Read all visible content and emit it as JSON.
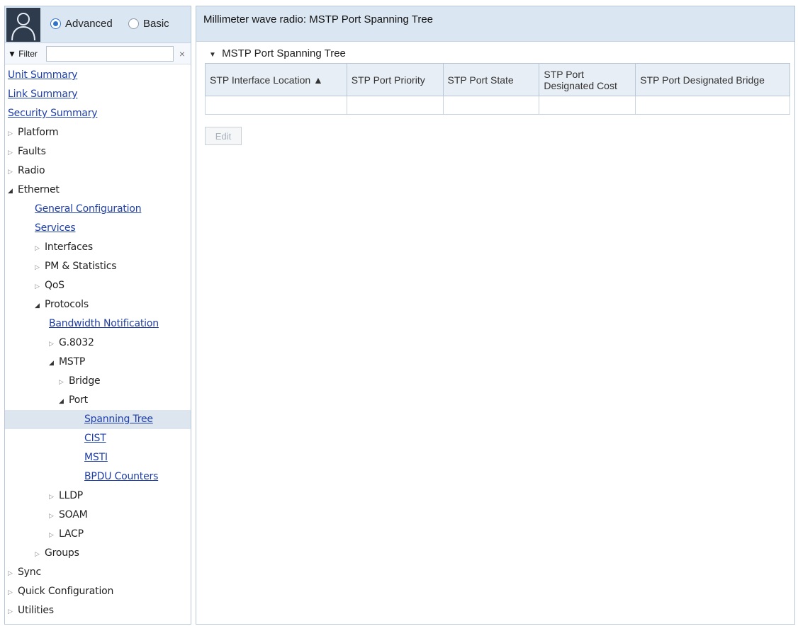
{
  "colors": {
    "header_bg": "#dbe6f3",
    "link": "#1f3fa8",
    "selected_bg": "#dde5ef",
    "avatar_bg": "#2e3b4c",
    "radio_accent": "#2f74c9"
  },
  "sidebar": {
    "avatar_icon": "user-silhouette-icon",
    "mode": {
      "advanced_label": "Advanced",
      "basic_label": "Basic",
      "selected": "Advanced"
    },
    "filter": {
      "label": "▼ Filter",
      "value": "",
      "clear_glyph": "×"
    },
    "tree": [
      {
        "label": "Unit Summary",
        "level": 0,
        "type": "link"
      },
      {
        "label": "Link Summary",
        "level": 0,
        "type": "link"
      },
      {
        "label": "Security Summary",
        "level": 0,
        "type": "link"
      },
      {
        "label": "Platform",
        "level": 0,
        "type": "collapsed"
      },
      {
        "label": "Faults",
        "level": 0,
        "type": "collapsed"
      },
      {
        "label": "Radio",
        "level": 0,
        "type": "collapsed"
      },
      {
        "label": "Ethernet",
        "level": 0,
        "type": "expanded"
      },
      {
        "label": "General Configuration",
        "level": 1,
        "type": "link"
      },
      {
        "label": "Services",
        "level": 1,
        "type": "link"
      },
      {
        "label": "Interfaces",
        "level": 1,
        "type": "collapsed"
      },
      {
        "label": "PM & Statistics",
        "level": 1,
        "type": "collapsed"
      },
      {
        "label": "QoS",
        "level": 1,
        "type": "collapsed"
      },
      {
        "label": "Protocols",
        "level": 1,
        "type": "expanded"
      },
      {
        "label": "Bandwidth Notification",
        "level": 2,
        "type": "link"
      },
      {
        "label": "G.8032",
        "level": 2,
        "type": "collapsed"
      },
      {
        "label": "MSTP",
        "level": 2,
        "type": "expanded"
      },
      {
        "label": "Bridge",
        "level": 3,
        "type": "collapsed"
      },
      {
        "label": "Port",
        "level": 3,
        "type": "expanded"
      },
      {
        "label": "Spanning Tree",
        "level": 4,
        "type": "link",
        "selected": true
      },
      {
        "label": "CIST",
        "level": 4,
        "type": "link"
      },
      {
        "label": "MSTI",
        "level": 4,
        "type": "link"
      },
      {
        "label": "BPDU Counters",
        "level": 4,
        "type": "link"
      },
      {
        "label": "LLDP",
        "level": 2,
        "type": "collapsed"
      },
      {
        "label": "SOAM",
        "level": 2,
        "type": "collapsed"
      },
      {
        "label": "LACP",
        "level": 2,
        "type": "collapsed"
      },
      {
        "label": "Groups",
        "level": 1,
        "type": "collapsed"
      },
      {
        "label": "Sync",
        "level": 0,
        "type": "collapsed"
      },
      {
        "label": "Quick Configuration",
        "level": 0,
        "type": "collapsed"
      },
      {
        "label": "Utilities",
        "level": 0,
        "type": "collapsed"
      }
    ]
  },
  "main": {
    "title": "Millimeter wave radio: MSTP Port Spanning Tree",
    "section_title": "MSTP Port Spanning Tree",
    "table": {
      "columns": [
        "STP Interface Location ▲",
        "STP Port Priority",
        "STP Port State",
        "STP Port Designated Cost",
        "STP Port Designated Bridge"
      ],
      "rows": [
        [
          "",
          "",
          "",
          "",
          ""
        ]
      ]
    },
    "edit_label": "Edit"
  }
}
